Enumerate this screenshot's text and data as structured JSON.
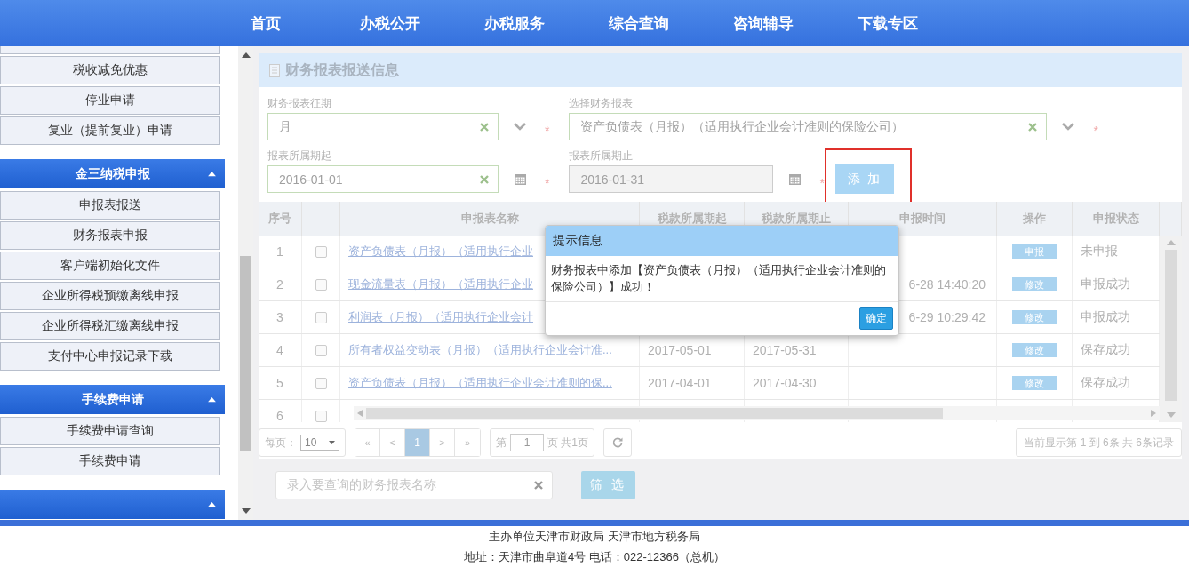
{
  "nav": {
    "items": [
      "首页",
      "办税公开",
      "办税服务",
      "综合查询",
      "咨询辅导",
      "下载专区"
    ]
  },
  "sidebar": {
    "sections": [
      {
        "items": [
          {
            "kind": "partial"
          },
          {
            "label": "税收减免优惠"
          },
          {
            "label": "停业申请"
          },
          {
            "label": "复业（提前复业）申请"
          }
        ]
      },
      {
        "header": {
          "title": "金三纳税申报",
          "expanded": true
        },
        "items": [
          {
            "label": "申报表报送"
          },
          {
            "label": "财务报表申报"
          },
          {
            "label": "客户端初始化文件"
          },
          {
            "label": "企业所得税预缴离线申报"
          },
          {
            "label": "企业所得税汇缴离线申报"
          },
          {
            "label": "支付中心申报记录下载"
          }
        ]
      },
      {
        "header": {
          "title": "手续费申请",
          "expanded": true
        },
        "items": [
          {
            "label": "手续费申请查询"
          },
          {
            "label": "手续费申请"
          }
        ]
      },
      {
        "header": {
          "expanded": true
        }
      }
    ]
  },
  "panel": {
    "title": "财务报表报送信息"
  },
  "form": {
    "fields": [
      {
        "kind": "select",
        "label": "财务报表征期",
        "value": "月",
        "disabled": false,
        "mark": "*"
      },
      {
        "kind": "select",
        "label": "选择财务报表",
        "value": "资产负债表（月报）（适用执行企业会计准则的保险公司）",
        "disabled": false,
        "mark": "*"
      },
      {
        "kind": "date",
        "label": "报表所属期起",
        "value": "2016-01-01",
        "disabled": false,
        "mark": "*"
      },
      {
        "kind": "date",
        "label": "报表所属期止",
        "value": "2016-01-31",
        "disabled": true,
        "mark": "*"
      }
    ],
    "add_button": {
      "label": "添 加",
      "highlighted": true
    }
  },
  "table": {
    "columns": [
      {
        "label": "序号"
      },
      {
        "kind": "checkbox"
      },
      {
        "label": "申报表名称"
      },
      {
        "label": "税款所属期起"
      },
      {
        "label": "税款所属期止"
      },
      {
        "label": "申报时间"
      },
      {
        "label": "操作"
      },
      {
        "label": "申报状态"
      }
    ],
    "rows": [
      {
        "seq": "1",
        "checked": false,
        "name": "资产负债表（月报）（适用执行企业",
        "action": "申报",
        "status": "未申报"
      },
      {
        "seq": "2",
        "checked": false,
        "name": "现金流量表（月报）（适用执行企业",
        "time": "6-28 14:40:20",
        "action": "修改",
        "status": "申报成功"
      },
      {
        "seq": "3",
        "checked": false,
        "name": "利润表（月报）（适用执行企业会计",
        "time": "6-29 10:29:42",
        "action": "修改",
        "status": "申报成功"
      },
      {
        "seq": "4",
        "checked": false,
        "name": "所有者权益变动表（月报）（适用执行企业会计准...",
        "start": "2017-05-01",
        "end": "2017-05-31",
        "action": "修改",
        "status": "保存成功"
      },
      {
        "seq": "5",
        "checked": false,
        "name": "资产负债表（月报）（适用执行企业会计准则的保...",
        "start": "2017-04-01",
        "end": "2017-04-30",
        "action": "修改",
        "status": "保存成功"
      },
      {
        "seq": "6",
        "checked": false
      }
    ]
  },
  "dialog": {
    "title": "提示信息",
    "message": "财务报表中添加【资产负债表（月报）（适用执行企业会计准则的保险公司）】成功！",
    "ok": "确定"
  },
  "pagination": {
    "page_size_label": "每页：",
    "page_size": "10",
    "pages": [
      {
        "label": "«",
        "selected": false
      },
      {
        "label": "<",
        "selected": false
      },
      {
        "label": "1",
        "selected": true
      },
      {
        "label": ">",
        "selected": false
      },
      {
        "label": "»",
        "selected": false
      }
    ],
    "goto_prefix": "第",
    "goto_value": "1",
    "goto_suffix": "页 共1页",
    "summary": "当前显示第 1 到 6条 共 6条记录"
  },
  "filter": {
    "placeholder": "录入要查询的财务报表名称",
    "button": "筛 选"
  },
  "footer": {
    "lines": [
      "主办单位天津市财政局 天津市地方税务局",
      "地址：天津市曲阜道4号 电话：022-12366（总机）"
    ]
  }
}
